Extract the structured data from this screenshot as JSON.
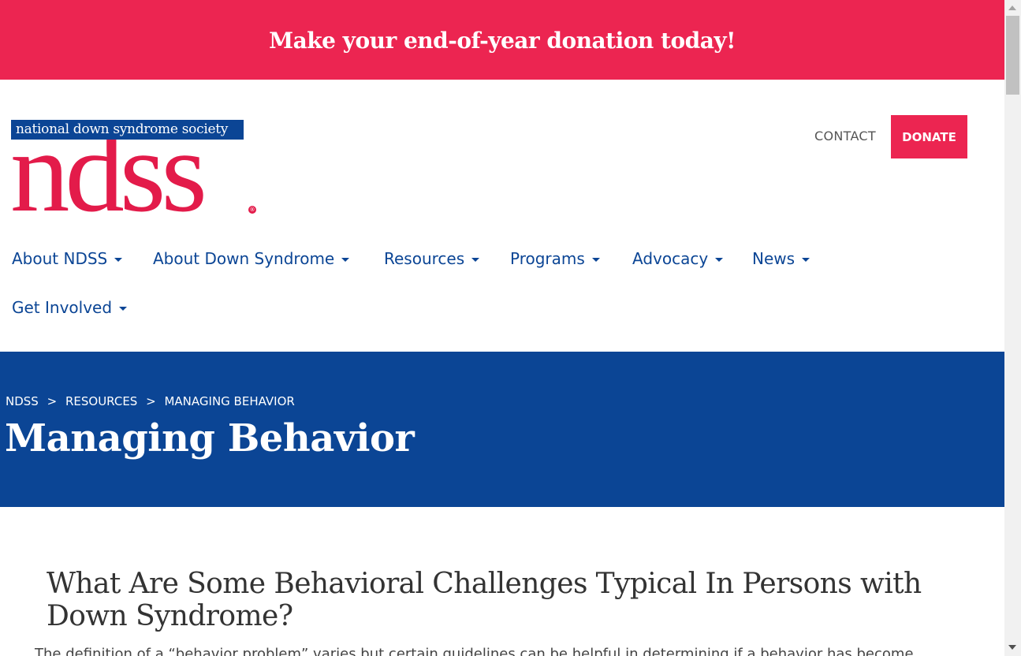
{
  "banner": {
    "text": "Make your end-of-year donation today!"
  },
  "logo": {
    "tagline": "national down syndrome society",
    "wordmark": "ndss",
    "registered": "®"
  },
  "header": {
    "contact_label": "CONTACT",
    "donate_label": "DONATE"
  },
  "nav": {
    "items": [
      {
        "label": "About NDSS"
      },
      {
        "label": "About Down Syndrome"
      },
      {
        "label": "Resources"
      },
      {
        "label": "Programs"
      },
      {
        "label": "Advocacy"
      },
      {
        "label": "News"
      },
      {
        "label": "Get Involved"
      }
    ]
  },
  "hero": {
    "breadcrumb": [
      "NDSS",
      "RESOURCES",
      "MANAGING BEHAVIOR"
    ],
    "separator": ">",
    "title": "Managing Behavior"
  },
  "content": {
    "heading": "What Are Some Behavioral Challenges Typical In Persons with Down Syndrome?",
    "paragraph": "The definition of a “behavior problem” varies but certain guidelines can be helpful in determining if a behavior has become"
  },
  "colors": {
    "brand_red": "#ec2551",
    "brand_blue": "#0b4595"
  },
  "icons": [
    "caret-down-icon",
    "scroll-up-arrow-icon",
    "scroll-down-arrow-icon"
  ]
}
